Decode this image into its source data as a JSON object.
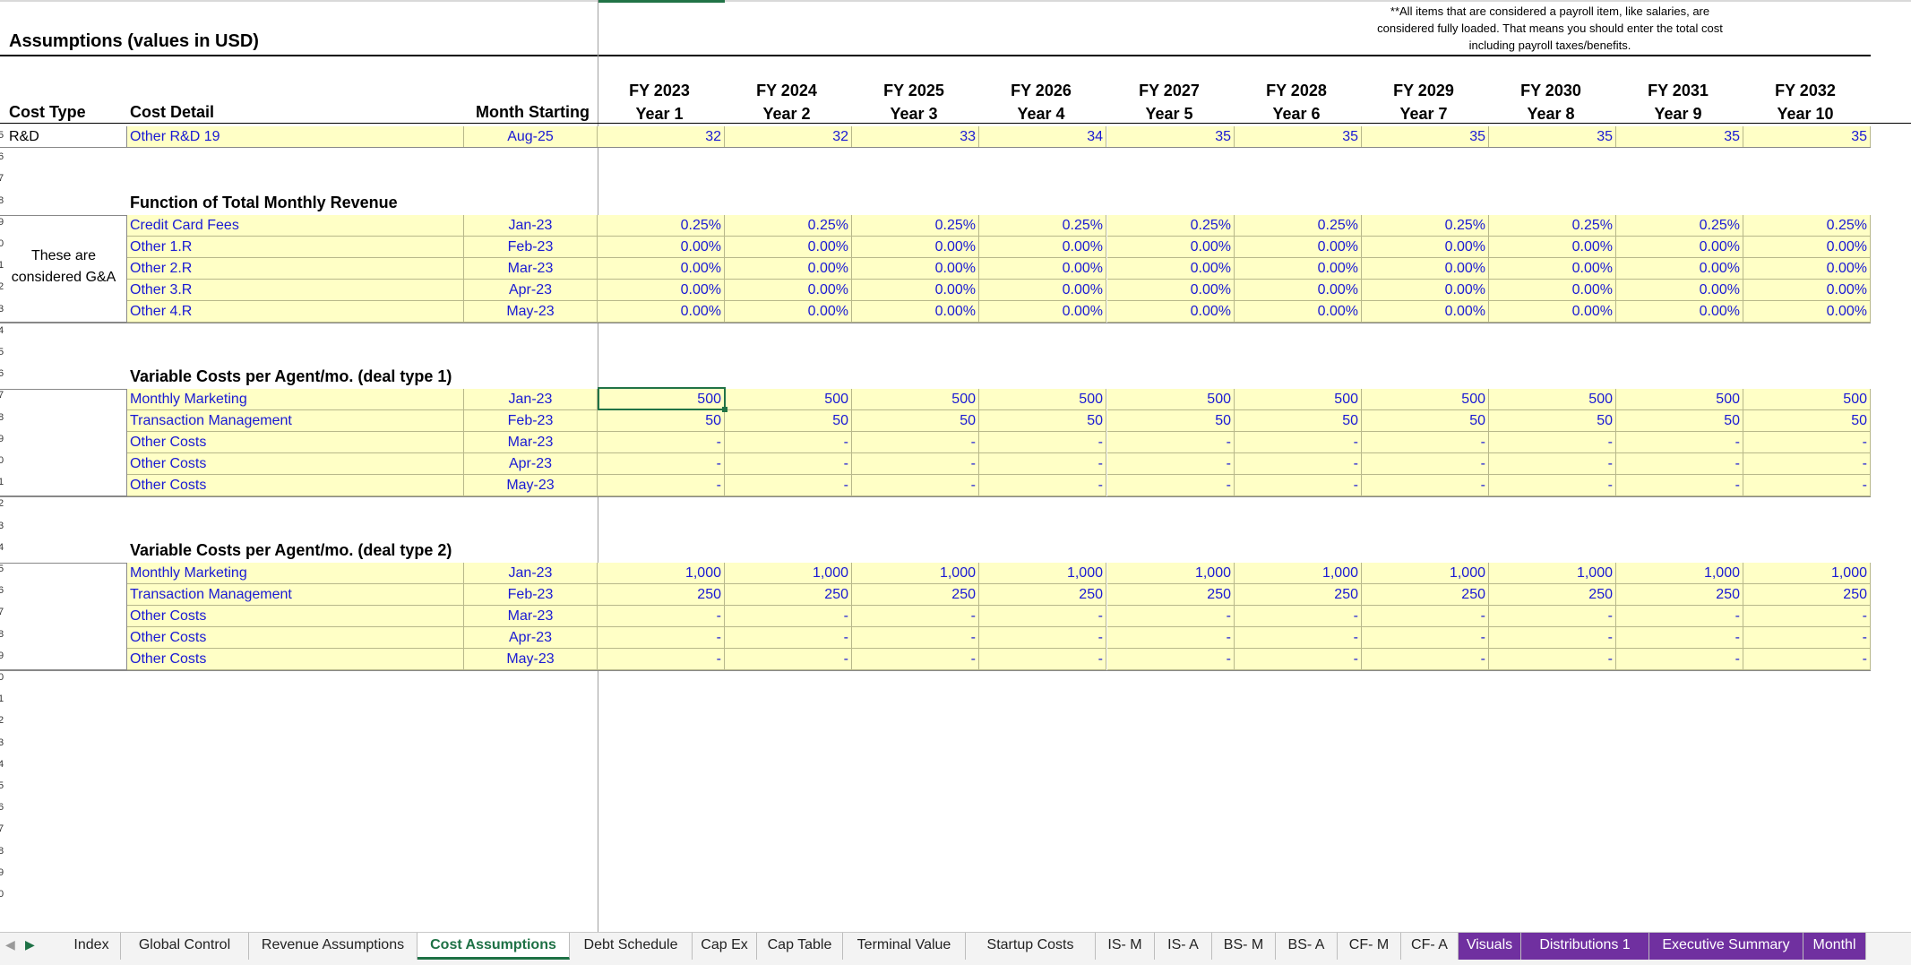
{
  "sheet": {
    "title": "Assumptions (values in USD)",
    "note": [
      "**All items that are considered a payroll item, like salaries, are",
      "considered fully loaded. That means you should enter the total cost",
      "including payroll taxes/benefits."
    ],
    "headers": {
      "cost_type": "Cost Type",
      "cost_detail": "Cost Detail",
      "month_starting": "Month Starting"
    },
    "years": [
      {
        "fy": "FY 2023",
        "yr": "Year 1"
      },
      {
        "fy": "FY 2024",
        "yr": "Year 2"
      },
      {
        "fy": "FY 2025",
        "yr": "Year 3"
      },
      {
        "fy": "FY 2026",
        "yr": "Year 4"
      },
      {
        "fy": "FY 2027",
        "yr": "Year 5"
      },
      {
        "fy": "FY 2028",
        "yr": "Year 6"
      },
      {
        "fy": "FY 2029",
        "yr": "Year 7"
      },
      {
        "fy": "FY 2030",
        "yr": "Year 8"
      },
      {
        "fy": "FY 2031",
        "yr": "Year 9"
      },
      {
        "fy": "FY 2032",
        "yr": "Year 10"
      }
    ],
    "rd_row": {
      "type": "R&D",
      "detail": "Other R&D 19",
      "month": "Aug-25",
      "values": [
        "32",
        "32",
        "33",
        "34",
        "35",
        "35",
        "35",
        "35",
        "35",
        "35"
      ]
    },
    "sections": [
      {
        "heading": "Function of Total Monthly Revenue",
        "side_label": [
          "These are",
          "considered G&A"
        ],
        "rows": [
          {
            "detail": "Credit Card Fees",
            "month": "Jan-23",
            "values": [
              "0.25%",
              "0.25%",
              "0.25%",
              "0.25%",
              "0.25%",
              "0.25%",
              "0.25%",
              "0.25%",
              "0.25%",
              "0.25%"
            ]
          },
          {
            "detail": "Other 1.R",
            "month": "Feb-23",
            "values": [
              "0.00%",
              "0.00%",
              "0.00%",
              "0.00%",
              "0.00%",
              "0.00%",
              "0.00%",
              "0.00%",
              "0.00%",
              "0.00%"
            ]
          },
          {
            "detail": "Other 2.R",
            "month": "Mar-23",
            "values": [
              "0.00%",
              "0.00%",
              "0.00%",
              "0.00%",
              "0.00%",
              "0.00%",
              "0.00%",
              "0.00%",
              "0.00%",
              "0.00%"
            ]
          },
          {
            "detail": "Other 3.R",
            "month": "Apr-23",
            "values": [
              "0.00%",
              "0.00%",
              "0.00%",
              "0.00%",
              "0.00%",
              "0.00%",
              "0.00%",
              "0.00%",
              "0.00%",
              "0.00%"
            ]
          },
          {
            "detail": "Other 4.R",
            "month": "May-23",
            "values": [
              "0.00%",
              "0.00%",
              "0.00%",
              "0.00%",
              "0.00%",
              "0.00%",
              "0.00%",
              "0.00%",
              "0.00%",
              "0.00%"
            ]
          }
        ]
      },
      {
        "heading": "Variable Costs per Agent/mo. (deal type 1)",
        "side_label": [],
        "rows": [
          {
            "detail": "Monthly Marketing",
            "month": "Jan-23",
            "values": [
              "500",
              "500",
              "500",
              "500",
              "500",
              "500",
              "500",
              "500",
              "500",
              "500"
            ]
          },
          {
            "detail": "Transaction Management",
            "month": "Feb-23",
            "values": [
              "50",
              "50",
              "50",
              "50",
              "50",
              "50",
              "50",
              "50",
              "50",
              "50"
            ]
          },
          {
            "detail": "Other Costs",
            "month": "Mar-23",
            "values": [
              "-",
              "-",
              "-",
              "-",
              "-",
              "-",
              "-",
              "-",
              "-",
              "-"
            ]
          },
          {
            "detail": "Other Costs",
            "month": "Apr-23",
            "values": [
              "-",
              "-",
              "-",
              "-",
              "-",
              "-",
              "-",
              "-",
              "-",
              "-"
            ]
          },
          {
            "detail": "Other Costs",
            "month": "May-23",
            "values": [
              "-",
              "-",
              "-",
              "-",
              "-",
              "-",
              "-",
              "-",
              "-",
              "-"
            ]
          }
        ]
      },
      {
        "heading": "Variable Costs per Agent/mo. (deal type 2)",
        "side_label": [],
        "rows": [
          {
            "detail": "Monthly Marketing",
            "month": "Jan-23",
            "values": [
              "1,000",
              "1,000",
              "1,000",
              "1,000",
              "1,000",
              "1,000",
              "1,000",
              "1,000",
              "1,000",
              "1,000"
            ]
          },
          {
            "detail": "Transaction Management",
            "month": "Feb-23",
            "values": [
              "250",
              "250",
              "250",
              "250",
              "250",
              "250",
              "250",
              "250",
              "250",
              "250"
            ]
          },
          {
            "detail": "Other Costs",
            "month": "Mar-23",
            "values": [
              "-",
              "-",
              "-",
              "-",
              "-",
              "-",
              "-",
              "-",
              "-",
              "-"
            ]
          },
          {
            "detail": "Other Costs",
            "month": "Apr-23",
            "values": [
              "-",
              "-",
              "-",
              "-",
              "-",
              "-",
              "-",
              "-",
              "-",
              "-"
            ]
          },
          {
            "detail": "Other Costs",
            "month": "May-23",
            "values": [
              "-",
              "-",
              "-",
              "-",
              "-",
              "-",
              "-",
              "-",
              "-",
              "-"
            ]
          }
        ]
      }
    ],
    "row_numbers": [
      "5",
      "6",
      "7",
      "8",
      "9",
      "0",
      "1",
      "2",
      "3",
      "4",
      "5",
      "6",
      "7",
      "8",
      "9",
      "0",
      "1",
      "2",
      "3",
      "4",
      "5",
      "6",
      "7",
      "8",
      "9",
      "0",
      "1",
      "2",
      "3",
      "4",
      "5",
      "6",
      "7",
      "8",
      "9",
      "0"
    ]
  },
  "tabs": [
    {
      "label": "Index",
      "style": "normal"
    },
    {
      "label": "Global Control",
      "style": "normal"
    },
    {
      "label": "Revenue Assumptions",
      "style": "normal"
    },
    {
      "label": "Cost Assumptions",
      "style": "active"
    },
    {
      "label": "Debt Schedule",
      "style": "normal"
    },
    {
      "label": "Cap Ex",
      "style": "normal"
    },
    {
      "label": "Cap Table",
      "style": "normal"
    },
    {
      "label": "Terminal Value",
      "style": "normal"
    },
    {
      "label": "Startup Costs",
      "style": "normal"
    },
    {
      "label": "IS- M",
      "style": "normal"
    },
    {
      "label": "IS- A",
      "style": "normal"
    },
    {
      "label": "BS- M",
      "style": "normal"
    },
    {
      "label": "BS- A",
      "style": "normal"
    },
    {
      "label": "CF- M",
      "style": "normal"
    },
    {
      "label": "CF- A",
      "style": "normal"
    },
    {
      "label": "Visuals",
      "style": "purple"
    },
    {
      "label": "Distributions 1",
      "style": "purple"
    },
    {
      "label": "Executive Summary",
      "style": "purple"
    },
    {
      "label": "Monthl",
      "style": "purple"
    }
  ],
  "colors": {
    "input_fill": "#ffffc6",
    "input_text": "#1a1ad4",
    "active_tab": "#1e7145",
    "purple_tab": "#7030a0"
  }
}
